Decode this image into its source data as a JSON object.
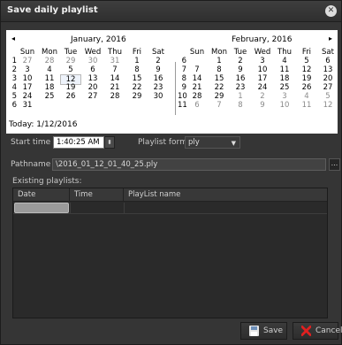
{
  "window": {
    "title": "Save daily playlist"
  },
  "calendar": {
    "left_month": {
      "title": "January, 2016",
      "headers": [
        "Sun",
        "Mon",
        "Tue",
        "Wed",
        "Thu",
        "Fri",
        "Sat"
      ],
      "weeks": [
        "1",
        "2",
        "3",
        "4",
        "5",
        "6"
      ],
      "rows": [
        [
          "27",
          "28",
          "29",
          "30",
          "31",
          "1",
          "2"
        ],
        [
          "3",
          "4",
          "5",
          "6",
          "7",
          "8",
          "9"
        ],
        [
          "10",
          "11",
          "12",
          "13",
          "14",
          "15",
          "16"
        ],
        [
          "17",
          "18",
          "19",
          "20",
          "21",
          "22",
          "23"
        ],
        [
          "24",
          "25",
          "26",
          "27",
          "28",
          "29",
          "30"
        ],
        [
          "31",
          "",
          "",
          "",
          "",
          "",
          ""
        ]
      ]
    },
    "right_month": {
      "title": "February, 2016",
      "headers": [
        "Sun",
        "Mon",
        "Tue",
        "Wed",
        "Thu",
        "Fri",
        "Sat"
      ],
      "weeks": [
        "6",
        "7",
        "8",
        "9",
        "10",
        "11"
      ],
      "rows": [
        [
          "",
          "1",
          "2",
          "3",
          "4",
          "5",
          "6"
        ],
        [
          "7",
          "8",
          "9",
          "10",
          "11",
          "12",
          "13"
        ],
        [
          "14",
          "15",
          "16",
          "17",
          "18",
          "19",
          "20"
        ],
        [
          "21",
          "22",
          "23",
          "24",
          "25",
          "26",
          "27"
        ],
        [
          "28",
          "29",
          "1",
          "2",
          "3",
          "4",
          "5"
        ],
        [
          "6",
          "7",
          "8",
          "9",
          "10",
          "11",
          "12"
        ]
      ]
    },
    "today_label": "Today: 1/12/2016",
    "prev_arrow": "◂",
    "next_arrow": "▸"
  },
  "form": {
    "start_time_label": "Start time",
    "start_time_value": "1:40:25 AM",
    "playlist_format_label": "Playlist format",
    "playlist_format_value": "ply",
    "pathname_label": "Pathname",
    "pathname_value": "\\2016_01_12_01_40_25.ply",
    "browse_label": "...",
    "existing_label": "Existing playlists:"
  },
  "table": {
    "columns": [
      "Date",
      "Time",
      "PlayList name"
    ]
  },
  "buttons": {
    "save_label": "Save",
    "cancel_label": "Cancel"
  }
}
